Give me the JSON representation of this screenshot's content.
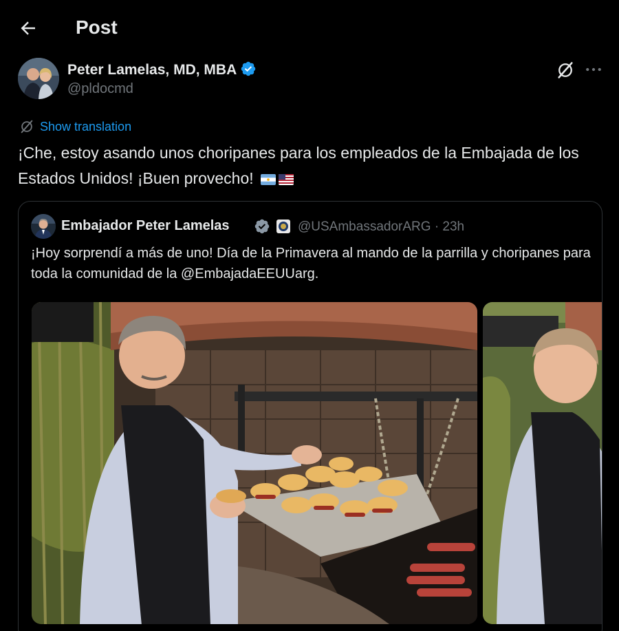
{
  "header": {
    "title": "Post",
    "back_icon": "arrow-left-icon"
  },
  "author": {
    "display_name": "Peter Lamelas, MD, MBA",
    "handle": "@pldocmd",
    "verified_icon": "verified-badge-icon",
    "verified_color": "#1d9bf0"
  },
  "translate": {
    "label": "Show translation",
    "icon": "grok-icon"
  },
  "tweet": {
    "text": "¡Che, estoy asando unos choripanes para los empleados de la Embajada de los Estados Unidos! ¡Buen provecho!",
    "emoji_flags": [
      "argentina-flag-icon",
      "usa-flag-icon"
    ]
  },
  "quoted": {
    "display_name": "Embajador Peter Lamelas",
    "handle": "@USAmbassadorARG",
    "timestamp": "· 23h",
    "text": "¡Hoy sorprendí a más de uno! Día de la Primavera al mando de la parrilla y choripanes para toda la comunidad de la @EmbajadaEEUUarg.",
    "media": [
      "photo-ambassador-at-grill",
      "photo-ambassador-side-view"
    ]
  },
  "colors": {
    "background": "#000000",
    "text": "#e7e9ea",
    "muted": "#71767b",
    "accent": "#1d9bf0",
    "border": "#2f3336"
  }
}
